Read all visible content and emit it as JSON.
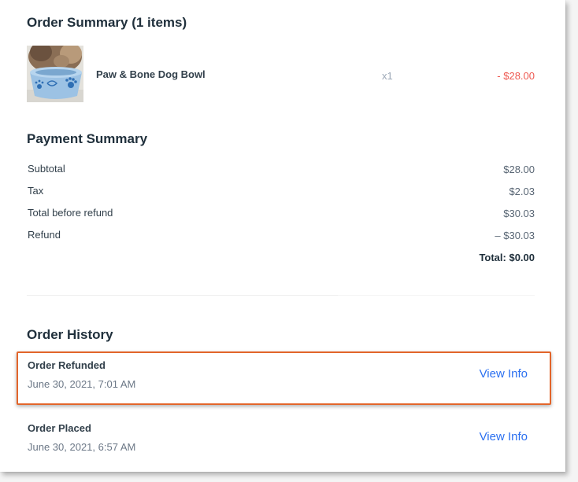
{
  "order_summary": {
    "title": "Order Summary (1 items)",
    "items": [
      {
        "name": "Paw & Bone Dog Bowl",
        "qty": "x1",
        "price": "- $28.00",
        "image": "dog-bowl-photo"
      }
    ]
  },
  "payment_summary": {
    "title": "Payment Summary",
    "rows": [
      {
        "label": "Subtotal",
        "value": "$28.00"
      },
      {
        "label": "Tax",
        "value": "$2.03"
      },
      {
        "label": "Total before refund",
        "value": "$30.03"
      },
      {
        "label": "Refund",
        "value": "– $30.03"
      }
    ],
    "total": "Total: $0.00"
  },
  "order_history": {
    "title": "Order History",
    "events": [
      {
        "title": "Order Refunded",
        "date": "June 30, 2021, 7:01 AM",
        "link": "View Info"
      },
      {
        "title": "Order Placed",
        "date": "June 30, 2021, 6:57 AM",
        "link": "View Info"
      }
    ]
  },
  "colors": {
    "accent_link": "#2a6ff0",
    "negative_price": "#ee5951",
    "highlight_border": "#e2652a"
  }
}
